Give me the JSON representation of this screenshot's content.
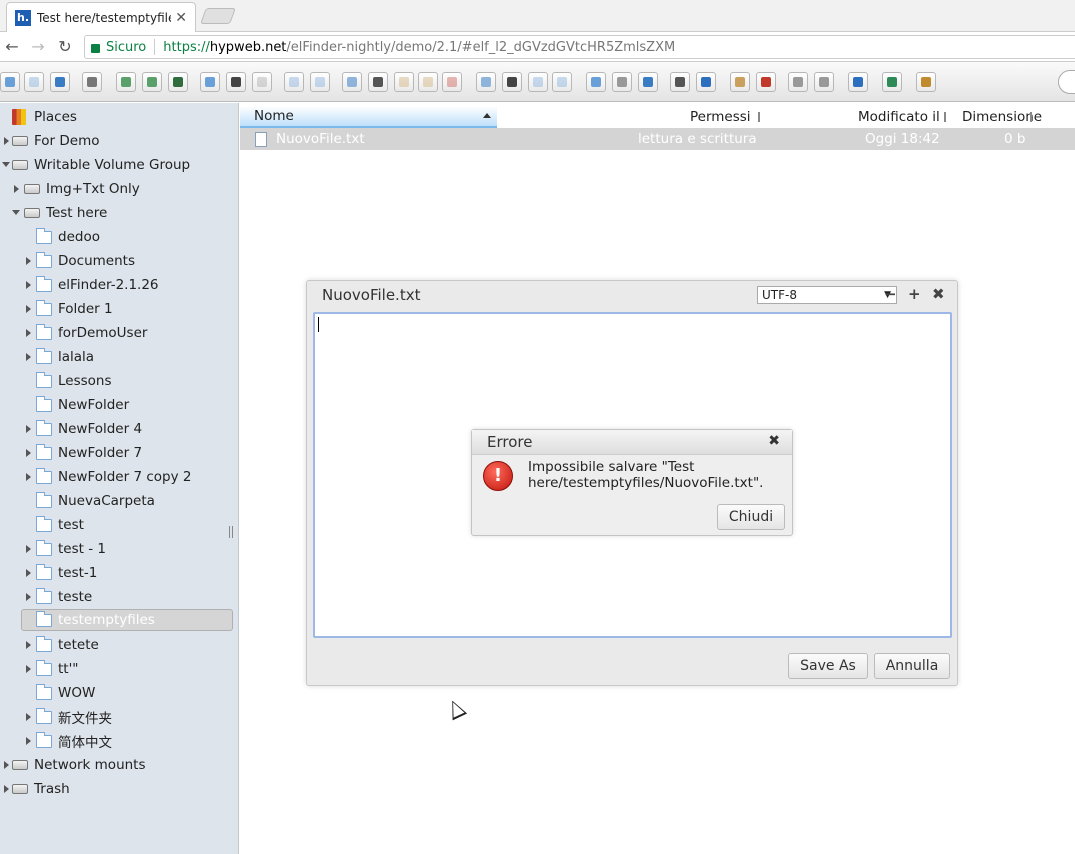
{
  "browser": {
    "tab_title": "Test here/testemptyfiles",
    "tab_close": "✕",
    "favicon_letter": "h.",
    "secure_label": "Sicuro",
    "url_proto": "https://",
    "url_host": "hypweb.net",
    "url_path": "/elFinder-nightly/demo/2.1/#elf_l2_dGVzdGVtcHR5ZmlsZXM",
    "back_icon": "←",
    "forward_icon": "→",
    "reload_icon": "↻"
  },
  "toolbar": {
    "buttons": [
      "back",
      "forward",
      "up",
      "home",
      "mkdir",
      "mkfile",
      "upload",
      "open",
      "save",
      "select",
      "undo",
      "redo",
      "copy",
      "cut",
      "paste",
      "duplicate",
      "remove",
      "rename",
      "edit",
      "resize",
      "view-icons",
      "view-list",
      "view-tree",
      "preview",
      "info",
      "extract",
      "archive",
      "sort",
      "netmount",
      "help",
      "fullscreen",
      "logout"
    ]
  },
  "tree": {
    "places": "Places",
    "items": [
      {
        "label": "For Demo"
      },
      {
        "label": "Writable Volume Group"
      },
      {
        "label": "Img+Txt Only"
      },
      {
        "label": "Test here"
      },
      {
        "label": "dedoo"
      },
      {
        "label": "Documents"
      },
      {
        "label": "elFinder-2.1.26"
      },
      {
        "label": "Folder 1"
      },
      {
        "label": "forDemoUser"
      },
      {
        "label": "lalala"
      },
      {
        "label": "Lessons"
      },
      {
        "label": "NewFolder"
      },
      {
        "label": "NewFolder 4"
      },
      {
        "label": "NewFolder 7"
      },
      {
        "label": "NewFolder 7 copy 2"
      },
      {
        "label": "NuevaCarpeta"
      },
      {
        "label": "test"
      },
      {
        "label": "test - 1"
      },
      {
        "label": "test-1"
      },
      {
        "label": "teste"
      },
      {
        "label": "testemptyfiles"
      },
      {
        "label": "tetete"
      },
      {
        "label": "tt'\""
      },
      {
        "label": "WOW"
      },
      {
        "label": "新文件夹"
      },
      {
        "label": "简体中文"
      },
      {
        "label": "Network mounts"
      },
      {
        "label": "Trash"
      }
    ]
  },
  "files": {
    "columns": {
      "name": "Nome",
      "perms": "Permessi",
      "modified": "Modificato il",
      "size": "Dimensione"
    },
    "rows": [
      {
        "name": "NuovoFile.txt",
        "perms": "lettura e scrittura",
        "modified": "Oggi 18:42",
        "size": "0 b"
      }
    ]
  },
  "editor": {
    "title": "NuovoFile.txt",
    "encoding": "UTF-8",
    "minimize": "−",
    "maximize": "+",
    "close": "✖",
    "save_as": "Save As",
    "cancel": "Annulla"
  },
  "error": {
    "title": "Errore",
    "close": "✖",
    "icon": "!",
    "message": "Impossibile salvare \"Test here/testemptyfiles/NuovoFile.txt\".",
    "ok": "Chiudi"
  }
}
